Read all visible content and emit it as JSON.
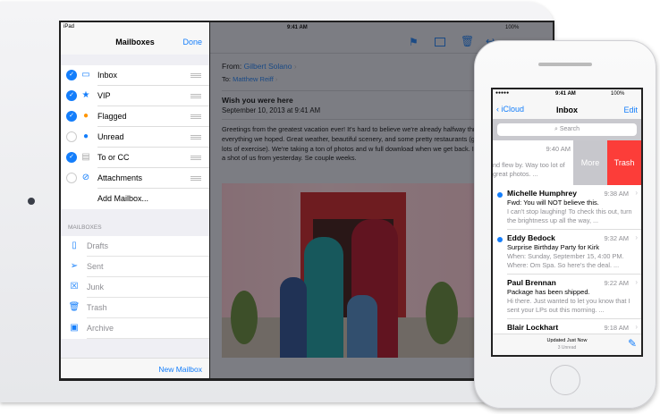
{
  "ipad": {
    "status": {
      "device": "iPad",
      "time": "9:41 AM",
      "battery": "100%"
    },
    "sidebar": {
      "title": "Mailboxes",
      "done": "Done",
      "smart_mailboxes": [
        {
          "label": "Inbox",
          "checked": true,
          "icon": "inbox-icon"
        },
        {
          "label": "VIP",
          "checked": true,
          "icon": "star-icon"
        },
        {
          "label": "Flagged",
          "checked": true,
          "icon": "flag-dot-icon"
        },
        {
          "label": "Unread",
          "checked": false,
          "icon": "unread-dot-icon"
        },
        {
          "label": "To or CC",
          "checked": true,
          "icon": "to-cc-icon"
        },
        {
          "label": "Attachments",
          "checked": false,
          "icon": "paperclip-icon"
        }
      ],
      "add_mailbox": "Add Mailbox...",
      "section_header": "MAILBOXES",
      "mailboxes": [
        {
          "label": "Drafts",
          "icon": "drafts-icon"
        },
        {
          "label": "Sent",
          "icon": "sent-icon"
        },
        {
          "label": "Junk",
          "icon": "junk-icon"
        },
        {
          "label": "Trash",
          "icon": "trash-icon"
        },
        {
          "label": "Archive",
          "icon": "archive-icon"
        }
      ],
      "new_mailbox": "New Mailbox"
    },
    "message": {
      "from_label": "From:",
      "from": "Gilbert Solano",
      "to_label": "To:",
      "to": "Matthew Reiff",
      "subject": "Wish you were here",
      "date": "September 10, 2013 at 9:41 AM",
      "body": "Greetings from the greatest vacation ever! It's hard to believe we're already halfway through our trip has been everything we hoped. Great weather, beautiful scenery, and some pretty restaurants (good thing we're getting lots of exercise). We're taking a ton of photos and w full download when we get back. In the meantime, here's a shot of us from yesterday. Se couple weeks."
    }
  },
  "iphone": {
    "status": {
      "signal": "●●●●●",
      "time": "9:41 AM",
      "battery": "100%"
    },
    "nav": {
      "back": "iCloud",
      "title": "Inbox",
      "edit": "Edit"
    },
    "search_placeholder": "Search",
    "swiped": {
      "time": "9:40 AM",
      "preview": "nd flew by. Way too lot of great photos. ...",
      "more": "More",
      "trash": "Trash"
    },
    "messages": [
      {
        "sender": "Michelle Humphrey",
        "time": "9:38 AM",
        "unread": true,
        "subject": "Fwd: You will NOT believe this.",
        "preview": "I can't stop laughing! To check this out, turn the brightness up all the way, ..."
      },
      {
        "sender": "Eddy Bedock",
        "time": "9:32 AM",
        "unread": true,
        "subject": "Surprise Birthday Party for Kirk",
        "preview": "When: Sunday, September 15, 4:00 PM. Where: Om Spa. So here's the deal. ..."
      },
      {
        "sender": "Paul Brennan",
        "time": "9:22 AM",
        "unread": false,
        "subject": "Package has been shipped.",
        "preview": "Hi there. Just wanted to let you know that I sent your LPs out this morning. ..."
      },
      {
        "sender": "Blair Lockhart",
        "time": "9:18 AM",
        "unread": false,
        "subject": "",
        "preview": ""
      }
    ],
    "toolbar": {
      "updated": "Updated Just Now",
      "unread": "3 Unread"
    }
  },
  "colors": {
    "accent": "#147efb",
    "trash": "#fc3d39",
    "more": "#c7c7cc"
  }
}
